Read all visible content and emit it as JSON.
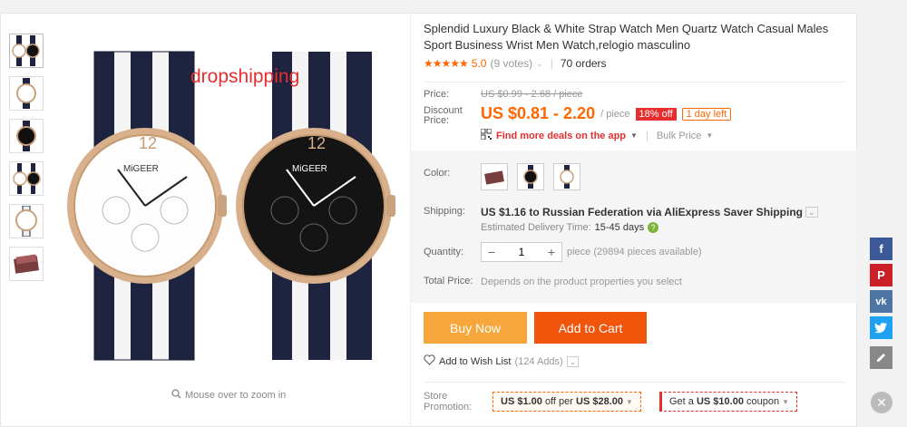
{
  "product": {
    "title": "Splendid Luxury Black & White Strap Watch Men Quartz Watch Casual Males Sport Business Wrist Men Watch,relogio masculino",
    "watermark": "dropshipping",
    "zoom_hint": "Mouse over to zoom in",
    "dial_brand": "MiGEER"
  },
  "rating": {
    "stars": "★★★★★",
    "score": "5.0",
    "votes": "(9 votes)",
    "orders": "70 orders"
  },
  "price": {
    "label": "Price:",
    "old": "US $0.99 - 2.68 / piece",
    "discount_label": "Discount Price:",
    "current": "US $0.81 - 2.20",
    "per": "/ piece",
    "off_badge": "18% off",
    "time_badge": "1 day left",
    "deals_link": "Find more deals on the app",
    "bulk": "Bulk Price"
  },
  "options": {
    "color_label": "Color:",
    "shipping_label": "Shipping:",
    "shipping_text": "US $1.16 to Russian Federation via AliExpress Saver Shipping",
    "estimated_label": "Estimated Delivery Time:",
    "estimated_days": "15-45 days",
    "quantity_label": "Quantity:",
    "quantity_value": "1",
    "quantity_available": "piece (29894 pieces available)",
    "total_label": "Total Price:",
    "total_desc": "Depends on the product properties you select"
  },
  "actions": {
    "buy_now": "Buy Now",
    "add_to_cart": "Add to Cart",
    "wish_label": "Add to Wish List",
    "wish_count": "(124 Adds)"
  },
  "promotion": {
    "label": "Store Promotion:",
    "coupon1_amount": "US $1.00",
    "coupon1_mid": "off per",
    "coupon1_threshold": "US $28.00",
    "coupon2_prefix": "Get a",
    "coupon2_amount": "US $10.00",
    "coupon2_suffix": "coupon"
  },
  "colors": {
    "accent": "#f60",
    "red": "#e62e2e",
    "buy_now": "#f6a63b",
    "add_to_cart": "#f1550b"
  }
}
